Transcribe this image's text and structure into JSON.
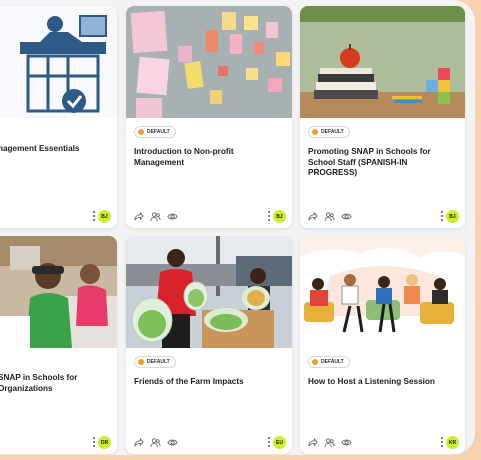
{
  "badge_label": "DEFAULT",
  "colors": {
    "badge_dot": "#f29a2e",
    "avatar_bg": "#c9f02b",
    "page_bg": "#f6d2b1"
  },
  "cards": [
    {
      "title": "nagement Essentials",
      "avatar": "BJ",
      "has_badge": false,
      "image": "office-illustration"
    },
    {
      "title": "Introduction to Non-profit Management",
      "avatar": "BJ",
      "has_badge": true,
      "image": "sticky-notes-wall"
    },
    {
      "title": "Promoting SNAP in Schools for School Staff (SPANISH-IN PROGRESS)",
      "avatar": "BJ",
      "has_badge": true,
      "image": "apple-on-books"
    },
    {
      "title": "SNAP in Schools for Organizations",
      "avatar": "DR",
      "has_badge": false,
      "image": "kids-eating"
    },
    {
      "title": "Friends of the Farm Impacts",
      "avatar": "EU",
      "has_badge": true,
      "image": "farm-produce"
    },
    {
      "title": "How to Host a Listening Session",
      "avatar": "KR",
      "has_badge": true,
      "image": "group-illustration"
    }
  ],
  "action_icons": [
    "share-icon",
    "people-icon",
    "eye-icon"
  ]
}
